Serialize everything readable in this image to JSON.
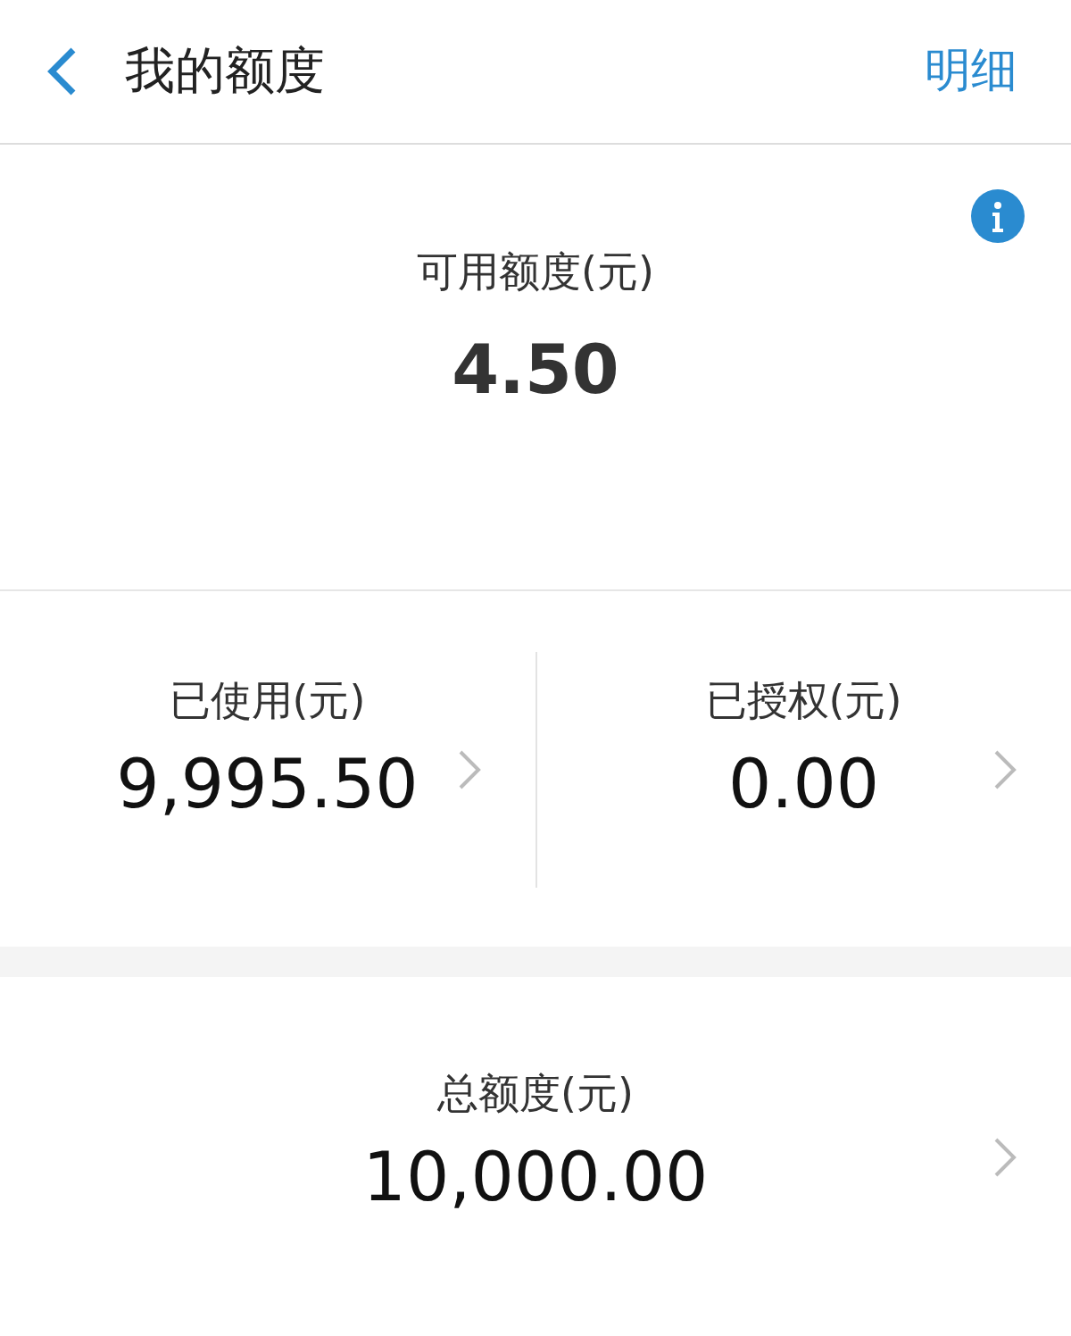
{
  "header": {
    "title": "我的额度",
    "action": "明细"
  },
  "available": {
    "label": "可用额度(元)",
    "amount": "4.50"
  },
  "stats": [
    {
      "label": "已使用(元)",
      "amount": "9,995.50"
    },
    {
      "label": "已授权(元)",
      "amount": "0.00"
    }
  ],
  "total": {
    "label": "总额度(元)",
    "amount": "10,000.00"
  }
}
